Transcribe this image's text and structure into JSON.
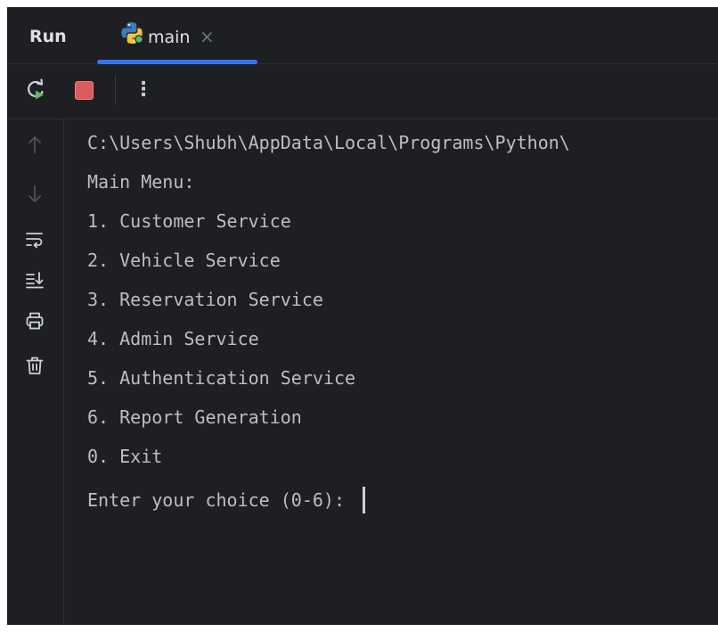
{
  "header": {
    "title": "Run",
    "tab": {
      "label": "main",
      "close": "×"
    }
  },
  "toolbar": {
    "rerun_icon": "rerun-icon",
    "stop_icon": "stop-icon",
    "more_icon": "more-vertical-icon",
    "more": "⋮"
  },
  "gutter": {
    "items": [
      {
        "icon": "arrow-up-icon",
        "enabled": false
      },
      {
        "icon": "arrow-down-icon",
        "enabled": false
      },
      {
        "icon": "soft-wrap-icon",
        "enabled": true
      },
      {
        "icon": "scroll-to-end-icon",
        "enabled": true
      },
      {
        "icon": "print-icon",
        "enabled": true
      },
      {
        "icon": "trash-icon",
        "enabled": true
      }
    ]
  },
  "console": {
    "path_line": "C:\\Users\\Shubh\\AppData\\Local\\Programs\\Python\\",
    "menu_header": "Main Menu:",
    "options": [
      "1. Customer Service",
      "2. Vehicle Service",
      "3. Reservation Service",
      "4. Admin Service",
      "5. Authentication Service",
      "6. Report Generation",
      "0. Exit"
    ],
    "prompt": "Enter your choice (0-6): "
  },
  "colors": {
    "background": "#1e1f22",
    "accent": "#3574f0",
    "stop": "#db5c5c",
    "rerun": "#5fb865",
    "text": "#bcbec4"
  }
}
